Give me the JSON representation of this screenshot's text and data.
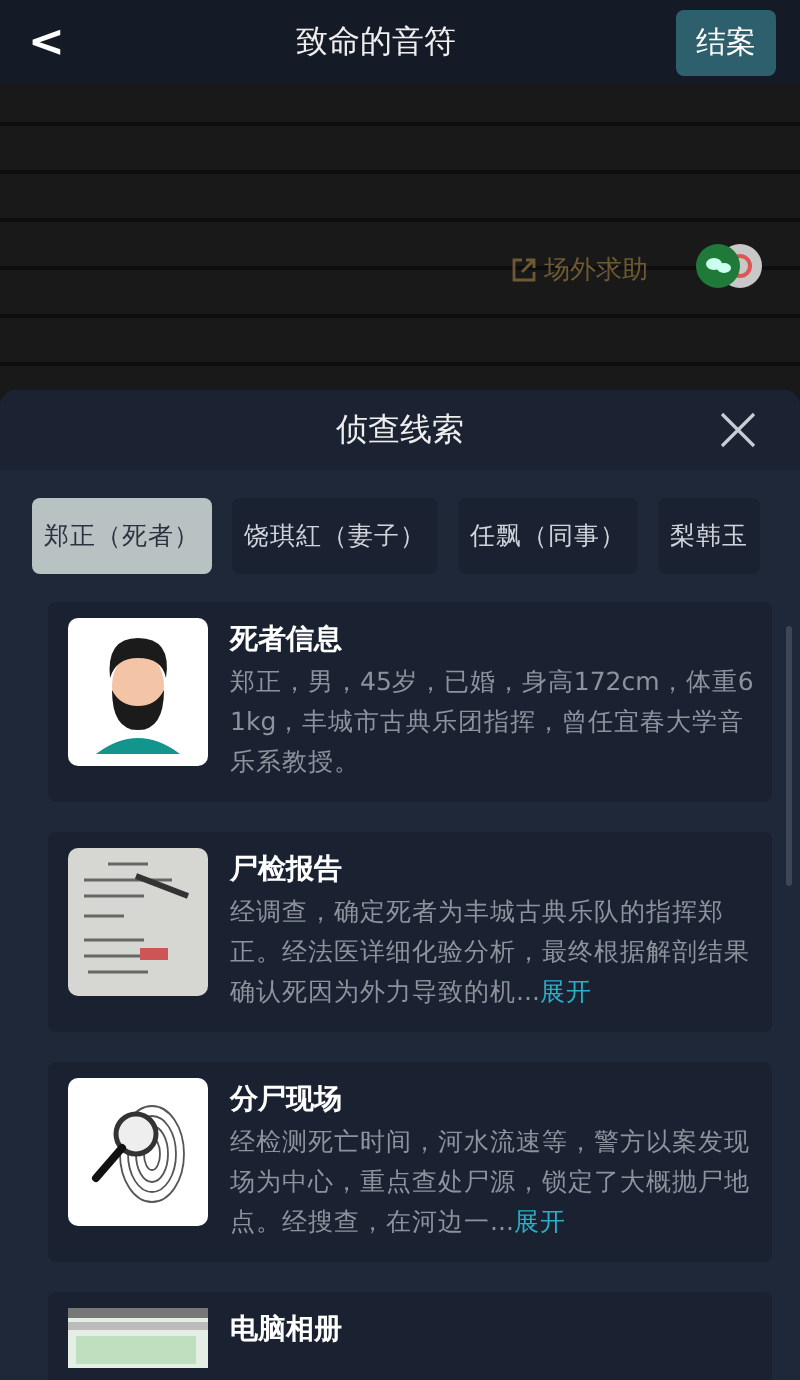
{
  "nav": {
    "title": "致命的音符",
    "back_label": "<",
    "action": "结案"
  },
  "scene": {
    "help_label": "场外求助"
  },
  "sheet": {
    "title": "侦查线索",
    "tabs": [
      {
        "label": "郑正（死者）",
        "selected": true
      },
      {
        "label": "饶琪紅（妻子）",
        "selected": false
      },
      {
        "label": "任飘（同事）",
        "selected": false
      },
      {
        "label": "梨韩玉",
        "selected": false
      }
    ],
    "clues": [
      {
        "kind": "avatar",
        "title": "死者信息",
        "text": "郑正，男，45岁，已婚，身高172cm，体重61kg，丰城市古典乐团指挥，曾任宜春大学音乐系教授。"
      },
      {
        "kind": "document",
        "title": "尸检报告",
        "text": "经调查，确定死者为丰城古典乐队的指挥郑正。经法医详细化验分析，最终根据解剖结果确认死因为外力导致的机...",
        "more": "展开"
      },
      {
        "kind": "fingerprint",
        "title": "分尸现场",
        "text": "经检测死亡时间，河水流速等，警方以案发现场为中心，重点查处尸源，锁定了大概抛尸地点。经搜查，在河边一...",
        "more": "展开"
      },
      {
        "kind": "screenshot",
        "title": "电脑相册"
      }
    ]
  }
}
